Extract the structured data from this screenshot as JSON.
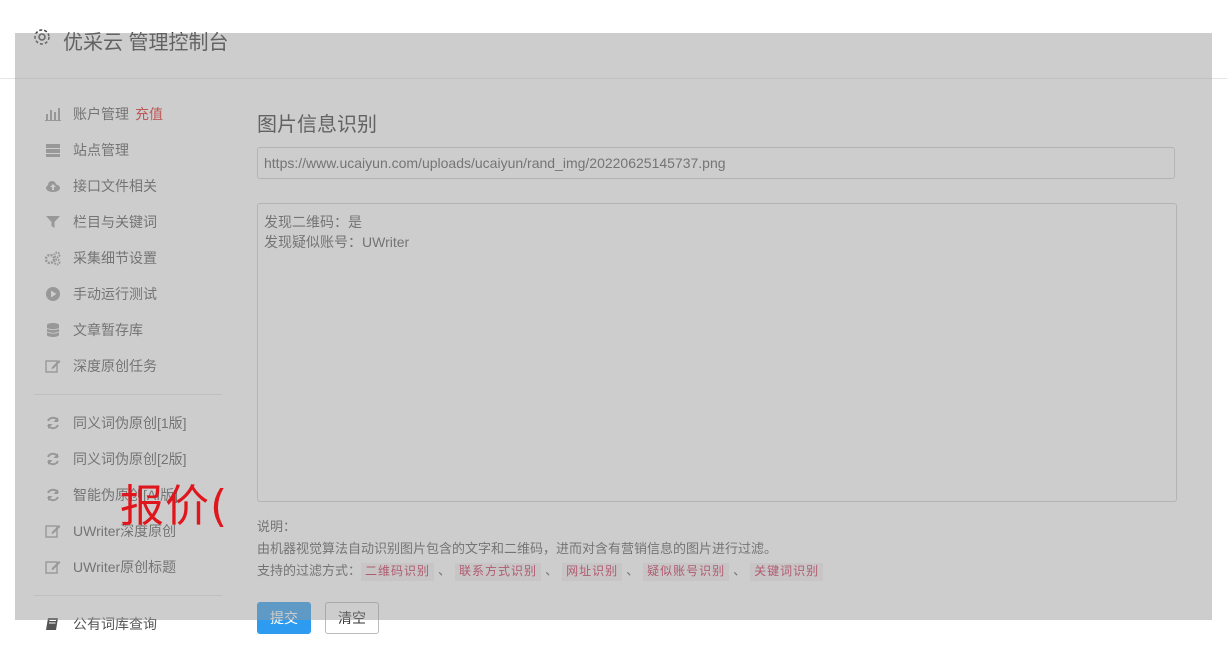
{
  "header": {
    "title": "优采云 管理控制台",
    "icon": "gear-icon"
  },
  "sidebar": {
    "group1": [
      {
        "label": "账户管理",
        "badge": "充值",
        "icon": "bar-chart-icon"
      },
      {
        "label": "站点管理",
        "icon": "server-icon"
      },
      {
        "label": "接口文件相关",
        "icon": "cloud-upload-icon"
      },
      {
        "label": "栏目与关键词",
        "icon": "filter-icon"
      },
      {
        "label": "采集细节设置",
        "icon": "gears-icon"
      },
      {
        "label": "手动运行测试",
        "icon": "play-circle-icon"
      },
      {
        "label": "文章暂存库",
        "icon": "database-icon"
      },
      {
        "label": "深度原创任务",
        "icon": "edit-icon"
      }
    ],
    "group2": [
      {
        "label": "同义词伪原创[1版]",
        "icon": "refresh-icon"
      },
      {
        "label": "同义词伪原创[2版]",
        "icon": "refresh-icon"
      },
      {
        "label": "智能伪原创[AI版]",
        "icon": "refresh-icon"
      },
      {
        "label": "UWriter深度原创",
        "icon": "edit-icon"
      },
      {
        "label": "UWriter原创标题",
        "icon": "edit-icon"
      }
    ],
    "group3": [
      {
        "label": "公有词库查询",
        "icon": "book-icon"
      }
    ]
  },
  "main": {
    "title": "图片信息识别",
    "url_value": "https://www.ucaiyun.com/uploads/ucaiyun/rand_img/20220625145737.png",
    "result_lines": [
      "发现二维码：是",
      "发现疑似账号：UWriter"
    ],
    "desc_heading": "说明：",
    "desc_text": "由机器视觉算法自动识别图片包含的文字和二维码，进而对含有营销信息的图片进行过滤。",
    "filter_label": "支持的过滤方式：",
    "filters": [
      "二维码识别",
      "联系方式识别",
      "网址识别",
      "疑似账号识别",
      "关键词识别"
    ],
    "filter_sep": "、",
    "submit_label": "提交",
    "clear_label": "清空"
  },
  "watermark": "报价(",
  "colors": {
    "primary": "#2d9cf0",
    "danger": "#e02020",
    "tag_text": "#c7254e",
    "tag_bg": "#f6f0f2"
  }
}
